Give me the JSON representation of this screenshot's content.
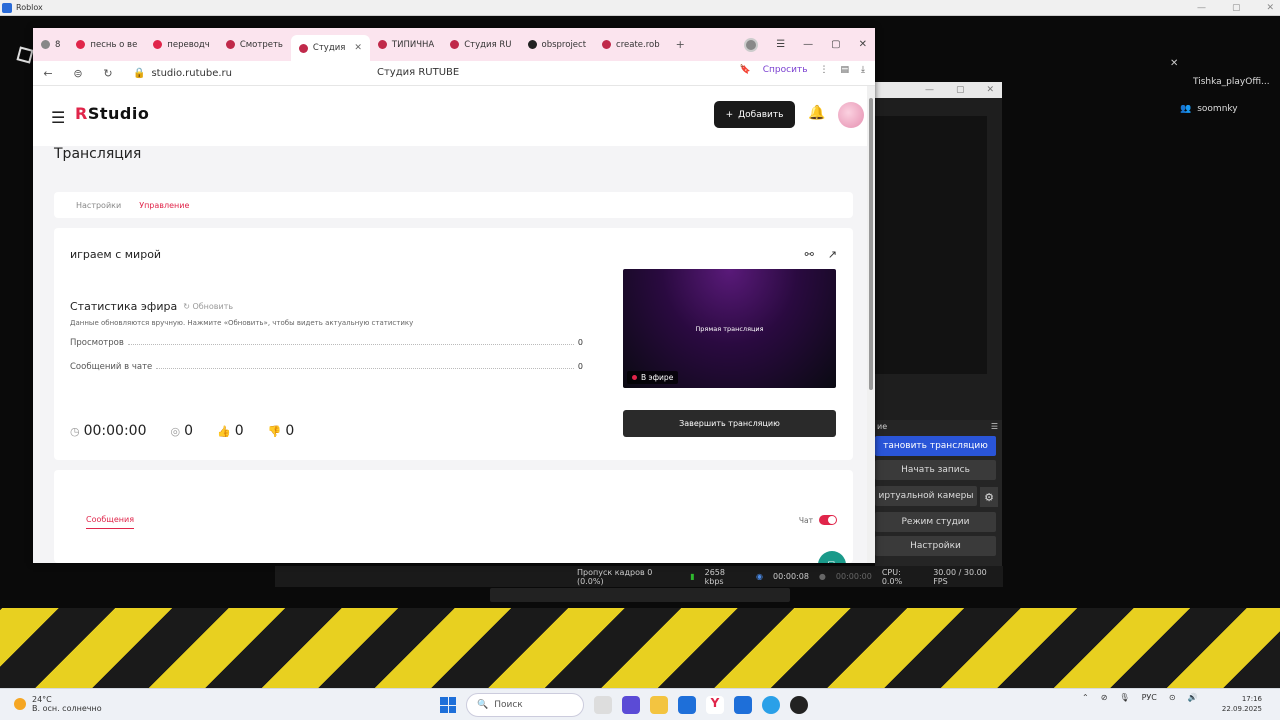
{
  "roblox": {
    "title": "Roblox"
  },
  "browser": {
    "tabs": [
      {
        "label": "8",
        "color": "#888888"
      },
      {
        "label": "песнь о ве",
        "color": "#e0254a"
      },
      {
        "label": "переводч",
        "color": "#e0254a"
      },
      {
        "label": "Смотреть",
        "color": "#c0294a"
      },
      {
        "label": "Студия",
        "color": "#c0294a",
        "active": true
      },
      {
        "label": "ТИПИЧНА",
        "color": "#c0294a"
      },
      {
        "label": "Студия RU",
        "color": "#c0294a"
      },
      {
        "label": "obsproject",
        "color": "#222222"
      },
      {
        "label": "create.rob",
        "color": "#c0294a"
      }
    ],
    "url": "studio.rutube.ru",
    "page_title": "Студия RUTUBE",
    "ask_label": "Спросить"
  },
  "studio": {
    "logo_r": "R",
    "logo_text": "Studio",
    "add_label": "Добавить",
    "page_heading": "Трансляция",
    "tabs": {
      "settings": "Настройки",
      "control": "Управление"
    },
    "stream_name": "играем с мирой",
    "stats_title": "Статистика эфира",
    "refresh": "Обновить",
    "stats_note": "Данные обновляются вручную. Нажмите «Обновить», чтобы видеть актуальную статистику",
    "views_label": "Просмотров",
    "views_value": "0",
    "messages_label": "Сообщений в чате",
    "messages_value": "0",
    "duration": "00:00:00",
    "viewers": "0",
    "likes": "0",
    "dislikes": "0",
    "preview_label": "Прямая трансляция",
    "live_badge": "В эфире",
    "end_button": "Завершить трансляцию",
    "messages_tab": "Сообщения",
    "chat_label": "Чат"
  },
  "obs": {
    "section": "ие",
    "stop_stream": "тановить трансляцию",
    "start_record": "Начать запись",
    "virtual_cam": "иртуальной камеры",
    "studio_mode": "Режим студии",
    "settings": "Настройки",
    "status": {
      "dropped": "Пропуск кадров 0 (0.0%)",
      "bitrate": "2658 kbps",
      "stream_time": "00:00:08",
      "rec_time": "00:00:00",
      "cpu": "CPU: 0.0%",
      "fps": "30.00 / 30.00 FPS"
    }
  },
  "side_users": {
    "u1": "Tishka_playOffi...",
    "u2": "soomnky"
  },
  "taskbar": {
    "temp": "24°C",
    "weather": "В. осн. солнечно",
    "search": "Поиск",
    "lang": "РУС",
    "time": "17:16",
    "date": "22.09.2025"
  }
}
